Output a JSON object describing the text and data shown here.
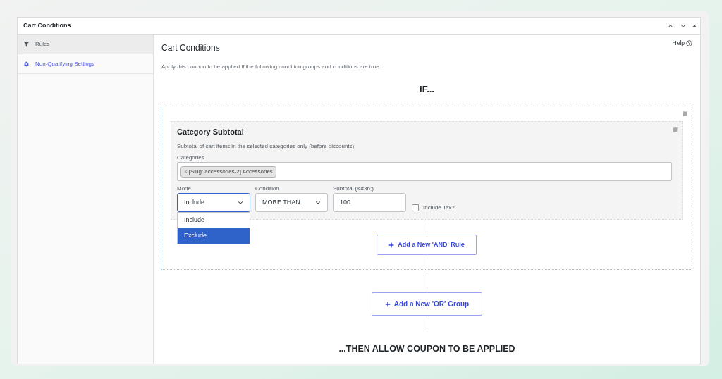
{
  "panel": {
    "title": "Cart Conditions"
  },
  "sidebar": {
    "items": [
      {
        "label": "Rules",
        "selected": true
      },
      {
        "label": "Non-Qualifying Settings",
        "selected": false
      }
    ]
  },
  "main": {
    "title": "Cart Conditions",
    "help": "Help",
    "description": "Apply this coupon to be applied if the following condition groups and conditions are true.",
    "if_label": "IF...",
    "groups": [
      {
        "conditions": [
          {
            "title": "Category Subtotal",
            "description": "Subtotal of cart items in the selected categories only (before discounts)",
            "categories": {
              "label": "Categories",
              "tags": [
                {
                  "remove": "×",
                  "label": "[Slug: accessories-2] Accessories"
                }
              ]
            },
            "mode": {
              "label": "Mode",
              "value": "Include",
              "expanded": true,
              "options": [
                {
                  "label": "Include",
                  "highlighted": false
                },
                {
                  "label": "Exclude",
                  "highlighted": true
                }
              ]
            },
            "condition": {
              "label": "Condition",
              "value": "MORE THAN"
            },
            "subtotal": {
              "label": "Subtotal (&#36;)",
              "value": "100"
            },
            "include_tax": {
              "label": "Include Tax?",
              "checked": false
            }
          }
        ],
        "add_rule_button": "Add a New 'AND' Rule"
      }
    ],
    "add_group_button": "Add a New 'OR' Group",
    "then_label": "...THEN ALLOW COUPON TO BE APPLIED"
  }
}
